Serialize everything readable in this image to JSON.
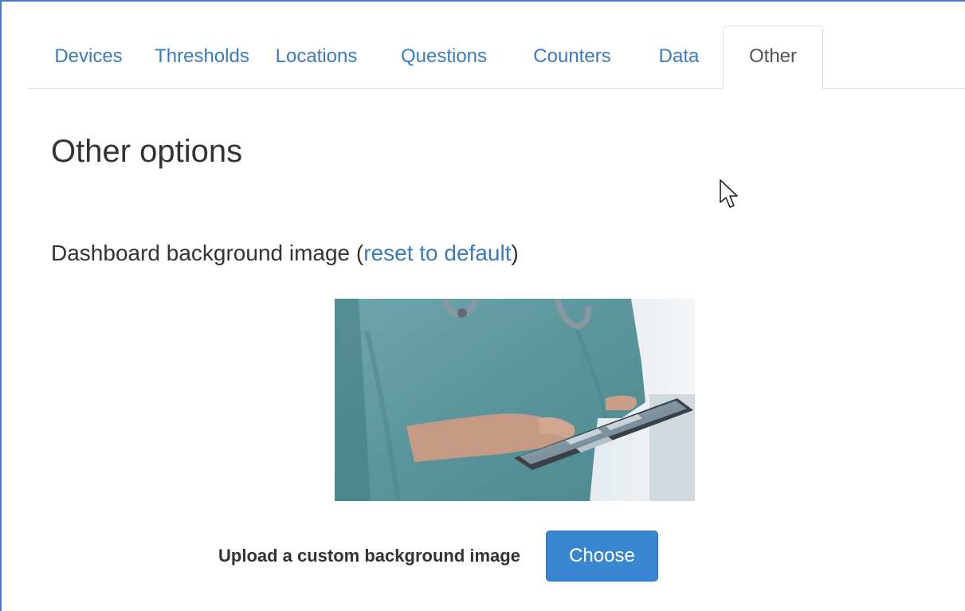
{
  "tabs": [
    {
      "label": "Devices",
      "active": false
    },
    {
      "label": "Thresholds",
      "active": false
    },
    {
      "label": "Locations",
      "active": false
    },
    {
      "label": "Questions",
      "active": false
    },
    {
      "label": "Counters",
      "active": false
    },
    {
      "label": "Data",
      "active": false
    },
    {
      "label": "Other",
      "active": true
    }
  ],
  "main": {
    "title": "Other options",
    "background": {
      "label": "Dashboard background image",
      "paren_open": "(",
      "reset_link": "reset to default",
      "paren_close": ")",
      "preview_icon": "clinician-with-tablet-photo"
    },
    "upload": {
      "label": "Upload a custom background image",
      "button_label": "Choose"
    }
  },
  "colors": {
    "link": "#3a7bbf",
    "button": "#3a87d1",
    "frame_border": "#4a78c2"
  },
  "icons": {
    "cursor": "mouse-pointer-icon"
  }
}
